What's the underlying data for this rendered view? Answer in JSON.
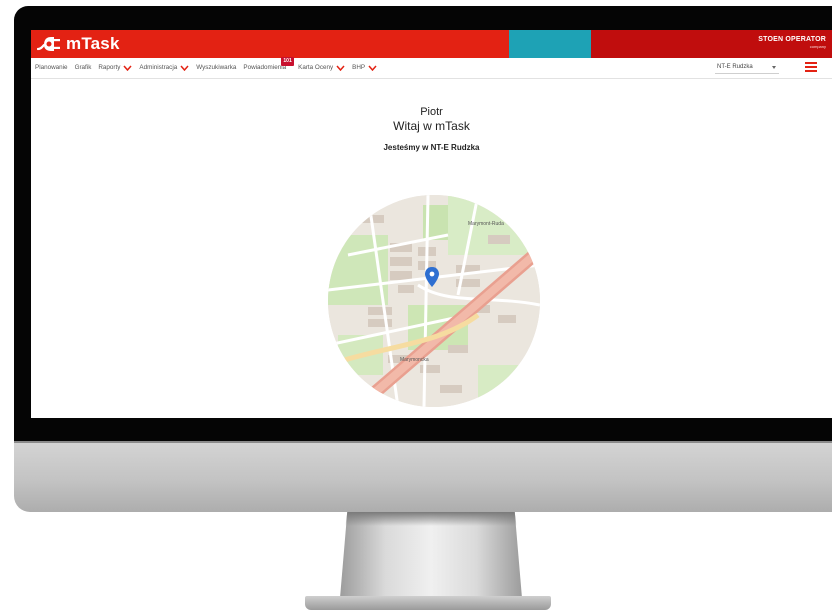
{
  "app": {
    "brand": "mTask",
    "operator_name": "STOEN OPERATOR",
    "operator_sub": "company"
  },
  "nav": {
    "items": [
      {
        "label": "Planowanie",
        "has_dropdown": false
      },
      {
        "label": "Grafik",
        "has_dropdown": false
      },
      {
        "label": "Raporty",
        "has_dropdown": true
      },
      {
        "label": "Administracja",
        "has_dropdown": true
      },
      {
        "label": "Wyszukiwarka",
        "has_dropdown": false
      },
      {
        "label": "Powiadomienia",
        "has_dropdown": false,
        "badge": "101"
      },
      {
        "label": "Karta Oceny",
        "has_dropdown": true
      },
      {
        "label": "BHP",
        "has_dropdown": true
      }
    ],
    "location_selected": "NT-E Rudzka",
    "menu_icon": "hamburger-icon"
  },
  "welcome": {
    "name": "Piotr",
    "greeting": "Witaj w mTask",
    "location_text": "Jesteśmy w NT-E Rudzka"
  },
  "map": {
    "marker_icon": "location-pin-icon",
    "labels": [
      "Marymont-Ruda",
      "Marymoncka"
    ]
  },
  "colors": {
    "brand_red": "#e32213",
    "teal": "#1ea2b5",
    "dark_red": "#c00d0d",
    "accent_chevron": "#e32213",
    "map_marker": "#2e6fd1"
  }
}
